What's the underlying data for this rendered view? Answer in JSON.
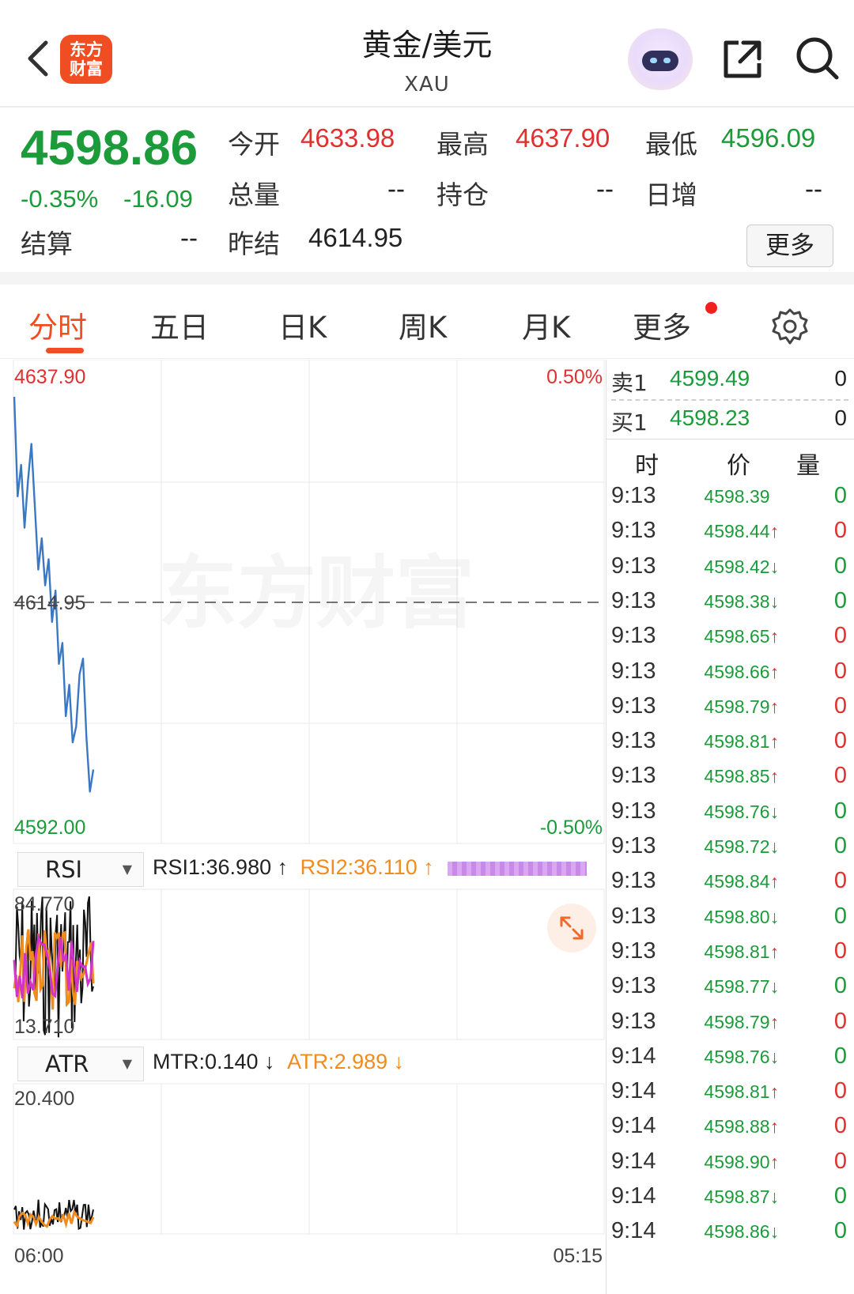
{
  "header": {
    "logo_text": "东方财富",
    "title": "黄金/美元",
    "subtitle": "XAU"
  },
  "quote": {
    "last": "4598.86",
    "change_pct": "-0.35%",
    "change_abs": "-16.09",
    "open_label": "今开",
    "open": "4633.98",
    "high_label": "最高",
    "high": "4637.90",
    "low_label": "最低",
    "low": "4596.09",
    "volume_label": "总量",
    "volume": "--",
    "oi_label": "持仓",
    "oi": "--",
    "daily_inc_label": "日增",
    "daily_inc": "--",
    "settle_label": "结算",
    "settle": "--",
    "prev_settle_label": "昨结",
    "prev_settle": "4614.95",
    "more_button": "更多"
  },
  "tabs": [
    {
      "label": "分时",
      "active": true
    },
    {
      "label": "五日",
      "active": false
    },
    {
      "label": "日K",
      "active": false
    },
    {
      "label": "周K",
      "active": false
    },
    {
      "label": "月K",
      "active": false
    },
    {
      "label": "更多",
      "active": false
    }
  ],
  "chart": {
    "top_price": "4637.90",
    "bottom_price": "4592.00",
    "mid_price": "4614.95",
    "top_pct": "0.50%",
    "bottom_pct": "-0.50%",
    "watermark": "东方财富",
    "time_start": "06:00",
    "time_end": "05:15"
  },
  "chart_data": {
    "type": "line",
    "ylim": [
      4592.0,
      4637.9
    ],
    "reference": 4614.95,
    "series": [
      {
        "values": [
          4634.5,
          4625.0,
          4628.0,
          4622.0,
          4626.5,
          4630.0,
          4624.0,
          4618.0,
          4621.0,
          4616.5,
          4619.0,
          4613.0,
          4616.0,
          4609.0,
          4611.0,
          4604.0,
          4607.0,
          4601.5,
          4603.0,
          4608.0,
          4609.5,
          4602.0,
          4596.8,
          4598.9
        ]
      }
    ]
  },
  "rsi": {
    "selector": "RSI",
    "rsi1": "RSI1:36.980 ↑",
    "rsi2": "RSI2:36.110 ↑",
    "top": "84.770",
    "bottom": "13.710"
  },
  "atr": {
    "selector": "ATR",
    "mtr": "MTR:0.140 ↓",
    "atr": "ATR:2.989 ↓",
    "top": "20.400"
  },
  "orderbook": {
    "ask_label": "卖1",
    "ask_price": "4599.49",
    "ask_qty": "0",
    "bid_label": "买1",
    "bid_price": "4598.23",
    "bid_qty": "0"
  },
  "ticks_header": {
    "time": "时",
    "price": "价",
    "qty": "量"
  },
  "ticks": [
    {
      "time": "9:13",
      "price": "4598.39",
      "dir": "",
      "qty": "0"
    },
    {
      "time": "9:13",
      "price": "4598.44",
      "dir": "↑",
      "qty": "0"
    },
    {
      "time": "9:13",
      "price": "4598.42",
      "dir": "↓",
      "qty": "0"
    },
    {
      "time": "9:13",
      "price": "4598.38",
      "dir": "↓",
      "qty": "0"
    },
    {
      "time": "9:13",
      "price": "4598.65",
      "dir": "↑",
      "qty": "0"
    },
    {
      "time": "9:13",
      "price": "4598.66",
      "dir": "↑",
      "qty": "0"
    },
    {
      "time": "9:13",
      "price": "4598.79",
      "dir": "↑",
      "qty": "0"
    },
    {
      "time": "9:13",
      "price": "4598.81",
      "dir": "↑",
      "qty": "0"
    },
    {
      "time": "9:13",
      "price": "4598.85",
      "dir": "↑",
      "qty": "0"
    },
    {
      "time": "9:13",
      "price": "4598.76",
      "dir": "↓",
      "qty": "0"
    },
    {
      "time": "9:13",
      "price": "4598.72",
      "dir": "↓",
      "qty": "0"
    },
    {
      "time": "9:13",
      "price": "4598.84",
      "dir": "↑",
      "qty": "0"
    },
    {
      "time": "9:13",
      "price": "4598.80",
      "dir": "↓",
      "qty": "0"
    },
    {
      "time": "9:13",
      "price": "4598.81",
      "dir": "↑",
      "qty": "0"
    },
    {
      "time": "9:13",
      "price": "4598.77",
      "dir": "↓",
      "qty": "0"
    },
    {
      "time": "9:13",
      "price": "4598.79",
      "dir": "↑",
      "qty": "0"
    },
    {
      "time": "9:14",
      "price": "4598.76",
      "dir": "↓",
      "qty": "0"
    },
    {
      "time": "9:14",
      "price": "4598.81",
      "dir": "↑",
      "qty": "0"
    },
    {
      "time": "9:14",
      "price": "4598.88",
      "dir": "↑",
      "qty": "0"
    },
    {
      "time": "9:14",
      "price": "4598.90",
      "dir": "↑",
      "qty": "0"
    },
    {
      "time": "9:14",
      "price": "4598.87",
      "dir": "↓",
      "qty": "0"
    },
    {
      "time": "9:14",
      "price": "4598.86",
      "dir": "↓",
      "qty": "0"
    }
  ],
  "colors": {
    "up": "#e03030",
    "down": "#1c9b3b",
    "accent": "#ef4e23",
    "price_line": "#3b78c4",
    "rsi1": "#f08c1e",
    "rsi2": "#d233c8"
  }
}
